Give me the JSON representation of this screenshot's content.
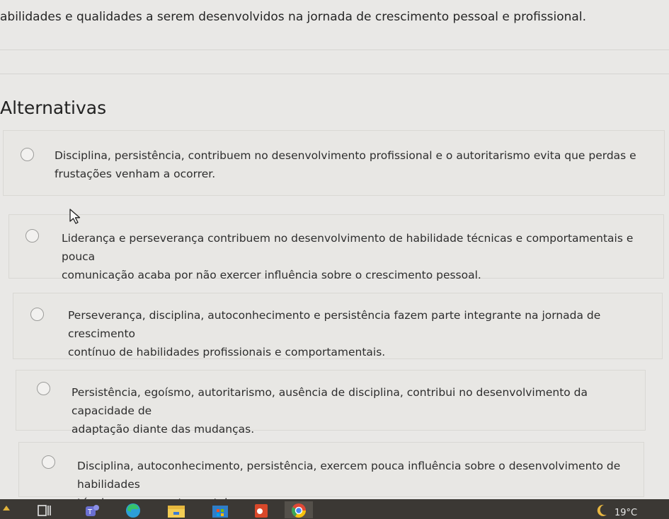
{
  "question": {
    "text": "abilidades e qualidades a serem desenvolvidos na jornada de crescimento pessoal e profissional."
  },
  "section_title": "Alternativas",
  "options": [
    {
      "line1": "Disciplina, persistência, contribuem no desenvolvimento profissional e o autoritarismo evita que perdas e",
      "line2": "frustações venham a ocorrer."
    },
    {
      "line1": "Liderança e perseverança contribuem no desenvolvimento de habilidade técnicas e comportamentais e pouca",
      "line2": "comunicação acaba por não exercer influência sobre o crescimento pessoal."
    },
    {
      "line1": "Perseverança, disciplina, autoconhecimento e persistência fazem parte integrante na jornada de crescimento",
      "line2": "contínuo de habilidades profissionais e comportamentais."
    },
    {
      "line1": "Persistência, egoísmo, autoritarismo, ausência de disciplina, contribui no desenvolvimento da capacidade de",
      "line2": "adaptação diante das mudanças."
    },
    {
      "line1": "Disciplina, autoconhecimento, persistência, exercem pouca influência sobre o desenvolvimento de habilidades",
      "line2": "técnicas e comportamentais."
    }
  ],
  "taskbar": {
    "icons": [
      "widgets-icon",
      "task-view-icon",
      "teams-icon",
      "edge-icon",
      "file-explorer-icon",
      "store-icon",
      "office-icon",
      "chrome-icon"
    ],
    "weather_text": "19°C"
  }
}
